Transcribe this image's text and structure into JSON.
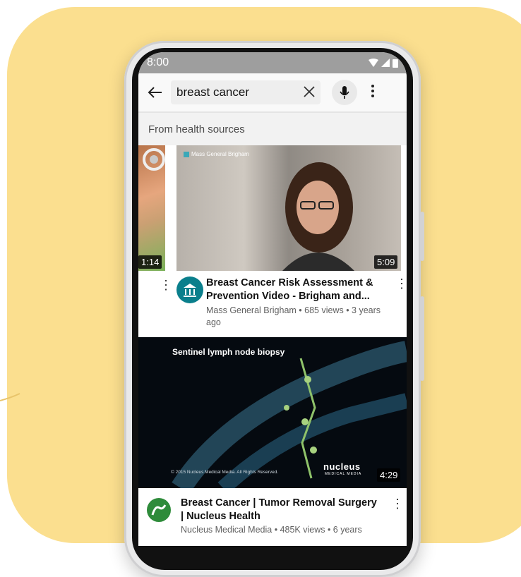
{
  "status": {
    "time": "8:00"
  },
  "topbar": {
    "query": "breast cancer"
  },
  "section": {
    "label": "From health sources"
  },
  "carousel": {
    "left_duration": "1:14",
    "main": {
      "duration": "5:09",
      "overlay_logo": "Mass General Brigham",
      "title": "Breast Cancer Risk Assessment & Prevention Video - Brigham and...",
      "meta": "Mass General Brigham • 685 views • 3 years ago"
    }
  },
  "video2": {
    "overlay_title": "Sentinel lymph node biopsy",
    "copyright": "© 2015 Nucleus Medical Media. All Rights Reserved.",
    "logo": "nucleus",
    "logo_sub": "MEDICAL MEDIA",
    "duration": "4:29",
    "title": "Breast Cancer | Tumor Removal Surgery | Nucleus Health",
    "meta": "Nucleus Medical Media • 485K views • 6 years"
  },
  "colors": {
    "background": "#fbdf8f",
    "channel_avatar": "#0a7f8c",
    "nucleus_logo": "#2e8b3a"
  },
  "icons": [
    "back-arrow-icon",
    "clear-icon",
    "microphone-icon",
    "more-vert-icon",
    "wifi-icon",
    "signal-icon",
    "battery-icon"
  ]
}
